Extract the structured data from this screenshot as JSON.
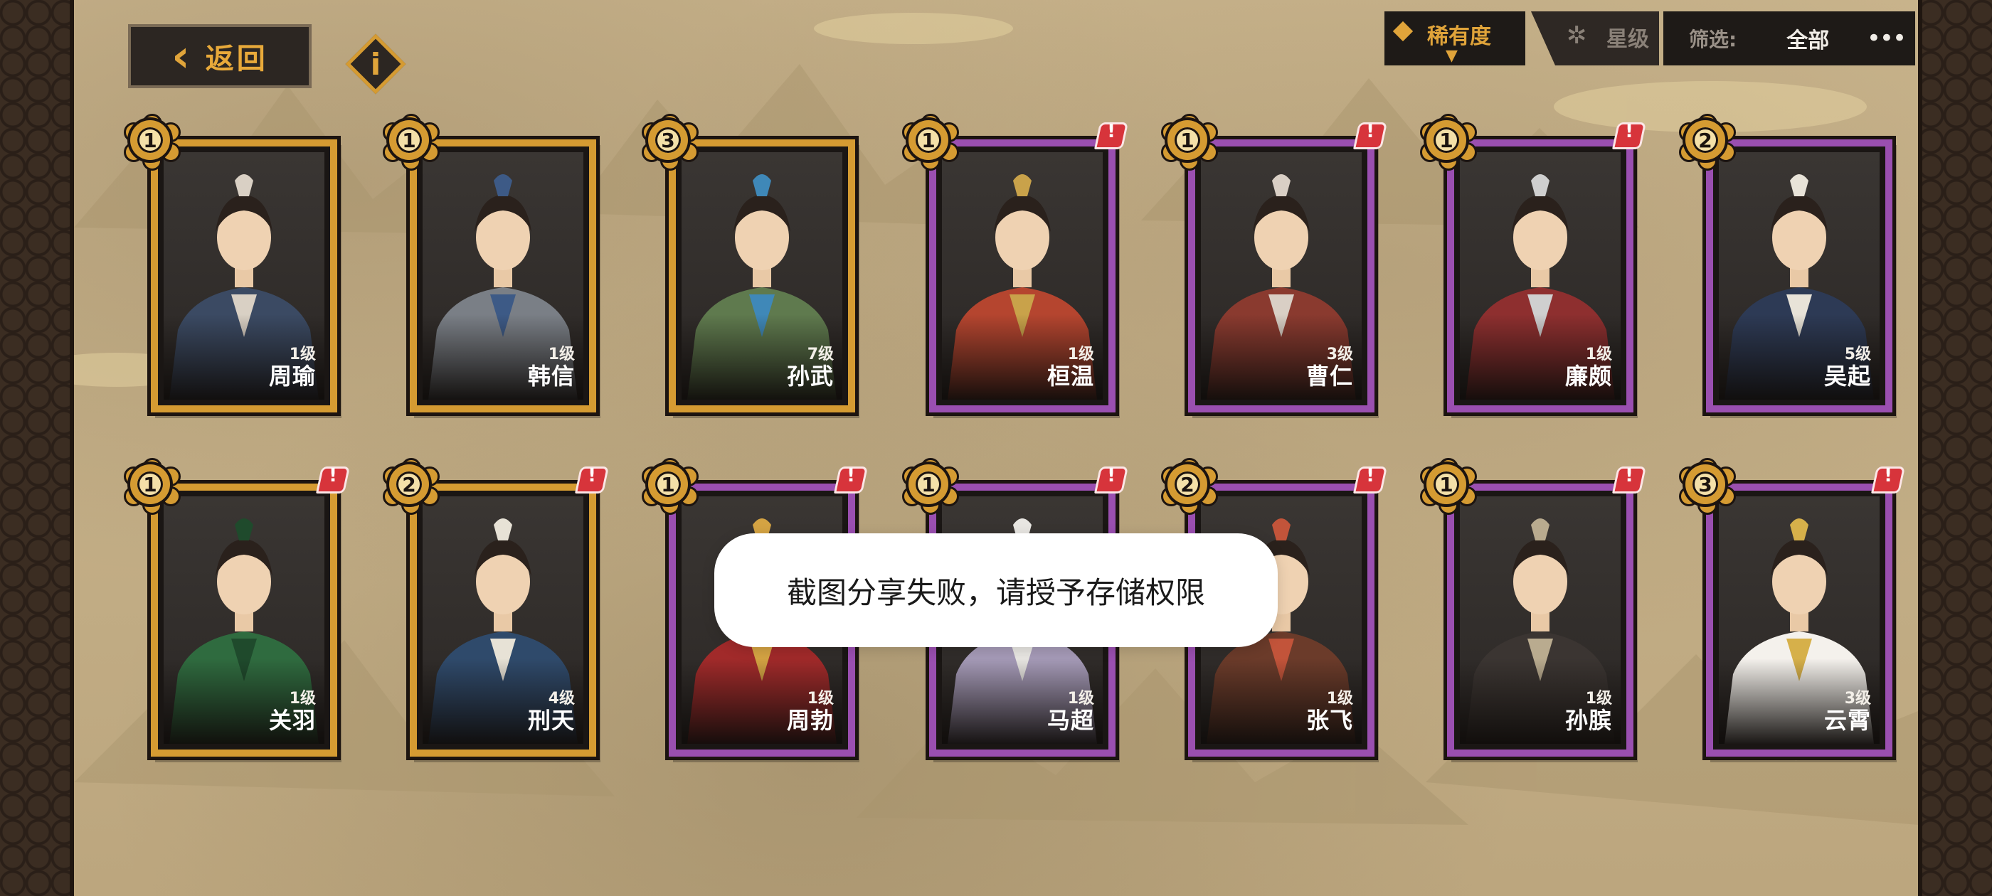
{
  "header": {
    "back_label": "返回",
    "info_label": "i"
  },
  "sort": {
    "rarity_label": "稀有度",
    "star_label": "星级",
    "active": "rarity"
  },
  "filter": {
    "label": "筛选:",
    "value": "全部",
    "more": "•••"
  },
  "heroes": [
    {
      "name": "周瑜",
      "level": "1级",
      "star": "1",
      "frame": "gold",
      "alert": false,
      "robe": "#3b4a63",
      "accent": "#d9d0c4"
    },
    {
      "name": "韩信",
      "level": "1级",
      "star": "1",
      "frame": "gold",
      "alert": false,
      "robe": "#7a7f86",
      "accent": "#3d5a86"
    },
    {
      "name": "孙武",
      "level": "7级",
      "star": "3",
      "frame": "gold",
      "alert": false,
      "robe": "#5f7a4e",
      "accent": "#3f88b8"
    },
    {
      "name": "桓温",
      "level": "1级",
      "star": "1",
      "frame": "purple",
      "alert": true,
      "robe": "#b5452f",
      "accent": "#c9a24a"
    },
    {
      "name": "曹仁",
      "level": "3级",
      "star": "1",
      "frame": "purple",
      "alert": true,
      "robe": "#8a3a2f",
      "accent": "#d9cfc5"
    },
    {
      "name": "廉颇",
      "level": "1级",
      "star": "1",
      "frame": "purple",
      "alert": true,
      "robe": "#8e2f2f",
      "accent": "#cfcfcf"
    },
    {
      "name": "吴起",
      "level": "5级",
      "star": "2",
      "frame": "purple",
      "alert": false,
      "robe": "#2d3a55",
      "accent": "#e8e3d8"
    },
    {
      "name": "关羽",
      "level": "1级",
      "star": "1",
      "frame": "gold",
      "alert": true,
      "robe": "#2f6b3f",
      "accent": "#1f4a2c"
    },
    {
      "name": "刑天",
      "level": "4级",
      "star": "2",
      "frame": "gold",
      "alert": true,
      "robe": "#2f4a6b",
      "accent": "#e7e2d6"
    },
    {
      "name": "周勃",
      "level": "1级",
      "star": "1",
      "frame": "purple",
      "alert": true,
      "robe": "#a12a2a",
      "accent": "#d4a343"
    },
    {
      "name": "马超",
      "level": "1级",
      "star": "1",
      "frame": "purple",
      "alert": true,
      "robe": "#a59ab7",
      "accent": "#e8e6e2"
    },
    {
      "name": "张飞",
      "level": "1级",
      "star": "2",
      "frame": "purple",
      "alert": true,
      "robe": "#6b3b2a",
      "accent": "#c2543a"
    },
    {
      "name": "孙膑",
      "level": "1级",
      "star": "1",
      "frame": "purple",
      "alert": true,
      "robe": "#3b3532",
      "accent": "#b9ab8f"
    },
    {
      "name": "云霄",
      "level": "3级",
      "star": "3",
      "frame": "purple",
      "alert": true,
      "robe": "#f4f1ec",
      "accent": "#d6b04a"
    }
  ],
  "toast": {
    "message": "截图分享失败，请授予存储权限"
  },
  "colors": {
    "gold_frame": "#d59b32",
    "purple_frame": "#9a4fb0",
    "alert_red": "#d7343b",
    "accent_orange": "#e0a43a"
  }
}
